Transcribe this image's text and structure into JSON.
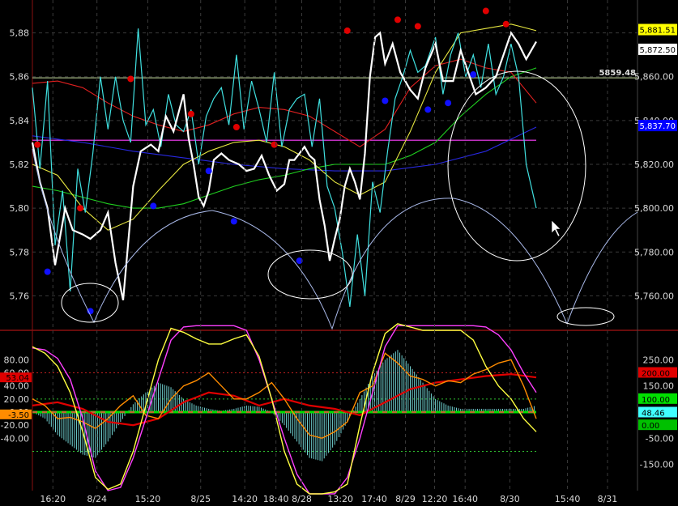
{
  "chart_data": [
    {
      "type": "line",
      "title": "",
      "xlabel": "",
      "ylabel": "",
      "ylim": [
        5745,
        5895
      ],
      "grid": true,
      "price_ticks": [
        "5,88",
        "5,86",
        "5,84",
        "5,82",
        "5,80",
        "5,78",
        "5,76"
      ],
      "price_tick_values": [
        5880,
        5860,
        5840,
        5820,
        5800,
        5780,
        5760
      ],
      "right_ticks": [
        "5,860.00",
        "5,840.00",
        "5,820.00",
        "5,800.00",
        "5,780.00",
        "5,760.00"
      ],
      "right_tick_values": [
        5860,
        5840,
        5820,
        5800,
        5780,
        5760
      ],
      "horizontal_line_label": "5859.48",
      "horizontal_line_value": 5859.48,
      "tags": [
        {
          "text": "5,881.51",
          "value": 5881.51,
          "bg": "#ffff00",
          "fg": "#000000"
        },
        {
          "text": "5,872.50",
          "value": 5872.5,
          "bg": "#ffffff",
          "fg": "#000000"
        },
        {
          "text": "5,837.70",
          "value": 5837.7,
          "bg": "#0000ff",
          "fg": "#ffffff"
        }
      ],
      "series": [
        {
          "color": "#ffffff",
          "x": [
            0,
            3,
            6,
            9,
            13,
            16,
            20,
            23,
            27,
            30,
            33,
            36,
            40,
            43,
            47,
            50,
            53,
            56,
            60,
            62,
            64,
            66,
            68,
            70,
            72,
            75,
            78,
            82,
            85,
            88,
            91,
            94,
            97,
            100,
            102,
            104,
            106,
            108,
            110,
            112,
            114,
            116,
            118,
            120,
            122,
            124,
            126,
            128,
            130,
            132,
            134,
            136,
            138,
            140,
            143,
            146,
            150,
            153,
            156,
            160,
            163,
            167,
            170,
            173,
            176,
            180,
            184,
            187,
            190,
            193,
            196,
            200
          ],
          "values": [
            5830,
            5812,
            5800,
            5774,
            5800,
            5790,
            5788,
            5786,
            5790,
            5798,
            5775,
            5758,
            5810,
            5826,
            5829,
            5826,
            5842,
            5835,
            5852,
            5832,
            5820,
            5805,
            5801,
            5808,
            5822,
            5825,
            5822,
            5820,
            5817,
            5818,
            5824,
            5815,
            5808,
            5811,
            5822,
            5822,
            5825,
            5828,
            5824,
            5822,
            5804,
            5792,
            5776,
            5786,
            5795,
            5810,
            5818,
            5812,
            5804,
            5825,
            5860,
            5878,
            5880,
            5866,
            5875,
            5862,
            5854,
            5850,
            5864,
            5875,
            5858,
            5858,
            5872,
            5862,
            5852,
            5855,
            5860,
            5870,
            5880,
            5875,
            5868,
            5876
          ]
        },
        {
          "color": "#40e0e0",
          "x": [
            0,
            3,
            6,
            9,
            12,
            15,
            18,
            21,
            24,
            27,
            30,
            33,
            36,
            39,
            42,
            45,
            48,
            51,
            54,
            57,
            60,
            63,
            66,
            69,
            72,
            75,
            78,
            81,
            84,
            87,
            90,
            93,
            96,
            99,
            102,
            105,
            108,
            111,
            114,
            117,
            120,
            123,
            126,
            129,
            132,
            135,
            138,
            141,
            144,
            147,
            150,
            153,
            156,
            160,
            163,
            166,
            169,
            172,
            175,
            178,
            181,
            184,
            187,
            190,
            193,
            196,
            200
          ],
          "values": [
            5855,
            5818,
            5858,
            5783,
            5808,
            5762,
            5818,
            5798,
            5825,
            5860,
            5836,
            5860,
            5840,
            5830,
            5882,
            5838,
            5845,
            5828,
            5852,
            5838,
            5835,
            5845,
            5820,
            5842,
            5850,
            5855,
            5838,
            5870,
            5836,
            5858,
            5845,
            5830,
            5862,
            5828,
            5845,
            5850,
            5852,
            5828,
            5850,
            5810,
            5800,
            5780,
            5755,
            5788,
            5760,
            5812,
            5798,
            5826,
            5850,
            5860,
            5872,
            5862,
            5865,
            5878,
            5852,
            5870,
            5880,
            5860,
            5870,
            5855,
            5875,
            5852,
            5860,
            5875,
            5860,
            5820,
            5800
          ]
        },
        {
          "color": "#e02020",
          "x": [
            0,
            10,
            20,
            30,
            40,
            50,
            60,
            70,
            80,
            90,
            100,
            110,
            120,
            130,
            140,
            150,
            160,
            170,
            180,
            190,
            200
          ],
          "values": [
            5857,
            5858,
            5855,
            5848,
            5842,
            5838,
            5835,
            5838,
            5843,
            5846,
            5845,
            5842,
            5835,
            5828,
            5836,
            5855,
            5865,
            5868,
            5864,
            5862,
            5848
          ]
        },
        {
          "color": "#20d020",
          "x": [
            0,
            10,
            20,
            30,
            40,
            50,
            60,
            70,
            80,
            90,
            100,
            110,
            120,
            130,
            140,
            150,
            160,
            170,
            180,
            190,
            200
          ],
          "values": [
            5810,
            5808,
            5805,
            5802,
            5800,
            5800,
            5802,
            5806,
            5810,
            5813,
            5815,
            5818,
            5820,
            5820,
            5820,
            5824,
            5830,
            5842,
            5852,
            5860,
            5864
          ]
        },
        {
          "color": "#e6e640",
          "x": [
            0,
            10,
            20,
            30,
            40,
            50,
            60,
            70,
            80,
            90,
            100,
            110,
            120,
            130,
            140,
            150,
            160,
            170,
            180,
            190,
            200
          ],
          "values": [
            5820,
            5815,
            5800,
            5790,
            5795,
            5808,
            5820,
            5826,
            5830,
            5831,
            5828,
            5822,
            5812,
            5806,
            5812,
            5835,
            5862,
            5880,
            5882,
            5884,
            5881
          ]
        },
        {
          "color": "#2828e0",
          "x": [
            0,
            20,
            40,
            60,
            80,
            100,
            120,
            140,
            160,
            180,
            200
          ],
          "values": [
            5833,
            5830,
            5826,
            5823,
            5820,
            5818,
            5817,
            5817,
            5820,
            5826,
            5837
          ]
        },
        {
          "color": "#ff40ff",
          "x": [
            0,
            200
          ],
          "values": [
            5831,
            5831
          ]
        }
      ],
      "high_marks": [
        {
          "x": 2,
          "y": 5829
        },
        {
          "x": 19,
          "y": 5800
        },
        {
          "x": 39,
          "y": 5859
        },
        {
          "x": 63,
          "y": 5843
        },
        {
          "x": 81,
          "y": 5837
        },
        {
          "x": 96,
          "y": 5829
        },
        {
          "x": 125,
          "y": 5881
        },
        {
          "x": 145,
          "y": 5886
        },
        {
          "x": 153,
          "y": 5883
        },
        {
          "x": 180,
          "y": 5890
        },
        {
          "x": 188,
          "y": 5884
        }
      ],
      "low_marks": [
        {
          "x": 6,
          "y": 5771
        },
        {
          "x": 23,
          "y": 5753
        },
        {
          "x": 48,
          "y": 5801
        },
        {
          "x": 70,
          "y": 5817
        },
        {
          "x": 80,
          "y": 5794
        },
        {
          "x": 106,
          "y": 5776
        },
        {
          "x": 140,
          "y": 5849
        },
        {
          "x": 157,
          "y": 5845
        },
        {
          "x": 165,
          "y": 5848
        },
        {
          "x": 175,
          "y": 5861
        }
      ]
    },
    {
      "type": "line",
      "title": "",
      "xlabel": "",
      "ylabel": "",
      "ylim": [
        -120,
        120
      ],
      "grid": true,
      "left_ticks": [
        "80.00",
        "60.00",
        "40.00",
        "20.00",
        "0.00",
        "-20.00",
        "-40.00"
      ],
      "left_tick_values": [
        80,
        60,
        40,
        20,
        0,
        -20,
        -40
      ],
      "right_ticks": [
        "250.00",
        "150.00",
        "50.00",
        "-50.00",
        "-150.00"
      ],
      "right_tick_values": [
        250,
        150,
        50,
        -50,
        -150
      ],
      "right_range": [
        -250,
        350
      ],
      "tags_left": [
        {
          "text": "53.04",
          "value": 53.04,
          "bg": "#e00000",
          "fg": "#000000"
        },
        {
          "text": "-3.50",
          "value": -3.5,
          "bg": "#ff8c00",
          "fg": "#000000"
        }
      ],
      "tags_right": [
        {
          "text": "200.00",
          "value": 200,
          "bg": "#e00000",
          "fg": "#000000"
        },
        {
          "text": "100.00",
          "value": 100,
          "bg": "#00e000",
          "fg": "#000000"
        },
        {
          "text": "48.46",
          "value": 48.46,
          "bg": "#40ffff",
          "fg": "#000000"
        },
        {
          "text": "0.00",
          "value": 0,
          "bg": "#00c000",
          "fg": "#000000"
        }
      ],
      "series": [
        {
          "color": "#ff40ff",
          "x": [
            0,
            5,
            10,
            15,
            20,
            25,
            30,
            35,
            40,
            45,
            50,
            55,
            60,
            65,
            70,
            75,
            80,
            85,
            90,
            95,
            100,
            105,
            110,
            115,
            120,
            125,
            130,
            135,
            140,
            145,
            150,
            155,
            160,
            165,
            170,
            175,
            180,
            185,
            190,
            195,
            200
          ],
          "values": [
            98,
            95,
            82,
            50,
            -10,
            -90,
            -120,
            -115,
            -70,
            -10,
            50,
            110,
            130,
            132,
            132,
            132,
            132,
            125,
            80,
            20,
            -40,
            -95,
            -125,
            -125,
            -125,
            -100,
            -40,
            30,
            100,
            132,
            132,
            132,
            132,
            132,
            132,
            132,
            130,
            118,
            95,
            60,
            30
          ]
        },
        {
          "color": "#ffff40",
          "x": [
            0,
            5,
            10,
            15,
            20,
            25,
            30,
            35,
            40,
            45,
            50,
            55,
            60,
            65,
            70,
            75,
            80,
            85,
            90,
            95,
            100,
            105,
            110,
            115,
            120,
            125,
            130,
            135,
            140,
            145,
            150,
            155,
            160,
            165,
            170,
            175,
            180,
            185,
            190,
            195,
            200
          ],
          "values": [
            100,
            90,
            70,
            30,
            -30,
            -100,
            -118,
            -110,
            -60,
            10,
            80,
            128,
            122,
            112,
            104,
            104,
            112,
            118,
            85,
            20,
            -60,
            -110,
            -125,
            -125,
            -122,
            -110,
            -20,
            60,
            120,
            135,
            130,
            125,
            125,
            125,
            125,
            110,
            70,
            40,
            20,
            -10,
            -30
          ]
        },
        {
          "color": "#ff8c00",
          "x": [
            0,
            5,
            10,
            15,
            20,
            25,
            30,
            35,
            40,
            45,
            50,
            55,
            60,
            65,
            70,
            75,
            80,
            85,
            90,
            95,
            100,
            105,
            110,
            115,
            120,
            125,
            130,
            135,
            140,
            145,
            150,
            155,
            160,
            165,
            170,
            175,
            180,
            185,
            190,
            195,
            200
          ],
          "values": [
            20,
            10,
            -10,
            -8,
            -15,
            -25,
            -10,
            10,
            25,
            -5,
            -10,
            20,
            40,
            48,
            60,
            40,
            20,
            20,
            30,
            45,
            20,
            -10,
            -35,
            -40,
            -30,
            -15,
            30,
            40,
            90,
            75,
            55,
            50,
            40,
            48,
            45,
            58,
            65,
            75,
            80,
            40,
            -10
          ]
        },
        {
          "color": "#e00000",
          "x": [
            0,
            10,
            20,
            30,
            40,
            50,
            60,
            70,
            80,
            90,
            100,
            110,
            120,
            130,
            140,
            150,
            160,
            170,
            180,
            190,
            200
          ],
          "values": [
            10,
            15,
            5,
            -15,
            -20,
            -10,
            15,
            30,
            25,
            10,
            20,
            10,
            5,
            -5,
            15,
            35,
            45,
            50,
            55,
            58,
            53
          ]
        }
      ],
      "histogram": {
        "color": "#70d0d0",
        "x": [
          0,
          5,
          10,
          15,
          20,
          25,
          30,
          35,
          40,
          45,
          50,
          55,
          60,
          65,
          70,
          75,
          80,
          85,
          90,
          95,
          100,
          105,
          110,
          115,
          120,
          125,
          130,
          135,
          140,
          145,
          150,
          155,
          160,
          165,
          170,
          175,
          180,
          185,
          190,
          195,
          200
        ],
        "values": [
          0,
          -10,
          -35,
          -50,
          -65,
          -70,
          -45,
          -15,
          12,
          30,
          45,
          38,
          20,
          10,
          5,
          2,
          5,
          10,
          8,
          0,
          -20,
          -45,
          -70,
          -75,
          -50,
          -15,
          20,
          55,
          80,
          95,
          70,
          45,
          20,
          10,
          5,
          5,
          5,
          5,
          5,
          5,
          10
        ]
      }
    }
  ],
  "x_axis_labels": [
    {
      "text": "16:20",
      "pos": 0.078
    },
    {
      "text": "8/24",
      "pos": 0.143
    },
    {
      "text": "15:20",
      "pos": 0.218
    },
    {
      "text": "8/25",
      "pos": 0.296
    },
    {
      "text": "14:20",
      "pos": 0.361
    },
    {
      "text": "18:40",
      "pos": 0.407
    },
    {
      "text": "8/28",
      "pos": 0.445
    },
    {
      "text": "13:20",
      "pos": 0.502
    },
    {
      "text": "17:40",
      "pos": 0.552
    },
    {
      "text": "8/29",
      "pos": 0.598
    },
    {
      "text": "12:20",
      "pos": 0.641
    },
    {
      "text": "16:40",
      "pos": 0.686
    },
    {
      "text": "8/30",
      "pos": 0.752
    },
    {
      "text": "15:40",
      "pos": 0.837
    },
    {
      "text": "8/31",
      "pos": 0.896
    }
  ],
  "colors": {
    "background": "#000000",
    "grid": "#3a3a3a",
    "axis_text": "#d8d8d8",
    "fib_arcs": "#a8b8e8",
    "ellipses": "#ffffff",
    "hline": "#c8e0a0"
  }
}
